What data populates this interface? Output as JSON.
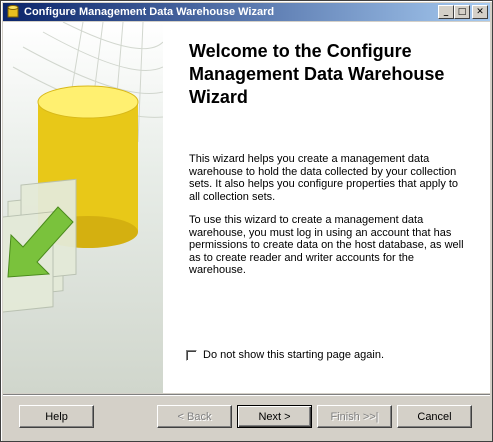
{
  "window": {
    "title": "Configure Management Data Warehouse Wizard",
    "minimize_label": "_",
    "maximize_label": "□",
    "close_label": "✕"
  },
  "main": {
    "heading": "Welcome to the Configure Management Data Warehouse Wizard",
    "paragraph1": "This wizard helps you create a management data warehouse to hold the data collected by your collection sets. It also helps you configure properties that apply to all collection sets.",
    "paragraph2": "To use this wizard to create a management data warehouse, you must log in using an account that has permissions to create data on the host database, as well as to create reader and writer accounts for the warehouse.",
    "checkbox_label": "Do not show this starting page again.",
    "checkbox_checked": false
  },
  "buttons": {
    "help": "Help",
    "back": "< Back",
    "next": "Next >",
    "finish": "Finish >>|",
    "cancel": "Cancel"
  },
  "colors": {
    "titlebar_start": "#0a246a",
    "titlebar_end": "#a6caf0",
    "dialog_face": "#d4d0c8",
    "cylinder": "#f0d020",
    "arrow": "#7ac23c"
  }
}
